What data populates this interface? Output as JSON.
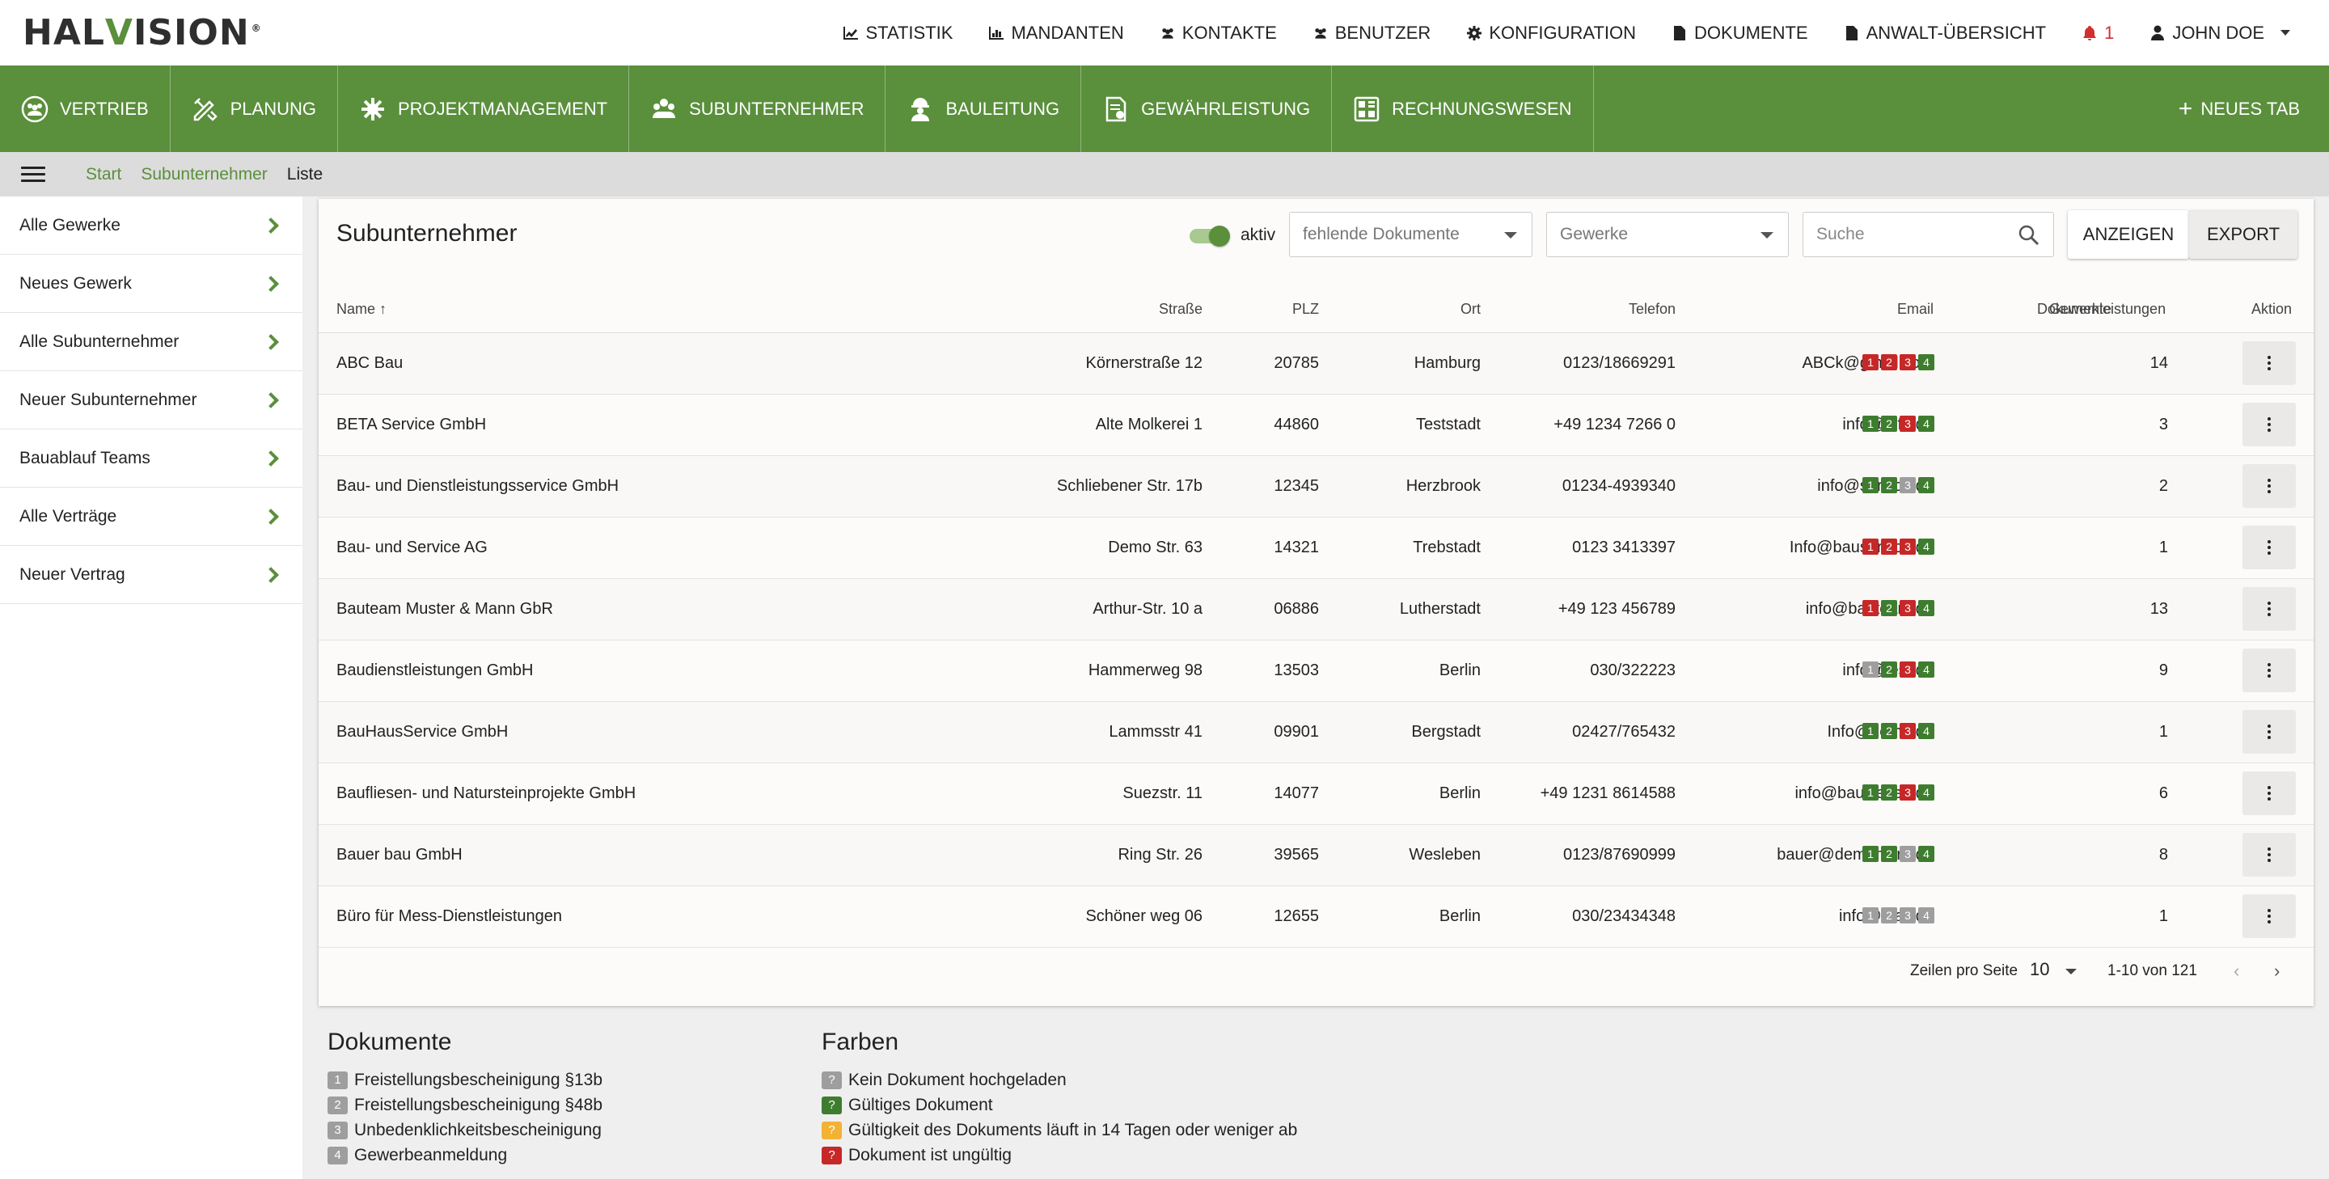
{
  "brand": {
    "logo_left": "HAL",
    "logo_v": "V",
    "logo_right": "ISION",
    "reg": "®"
  },
  "topnav": [
    {
      "label": "STATISTIK",
      "icon": "chart-line-icon"
    },
    {
      "label": "MANDANTEN",
      "icon": "bar-chart-icon"
    },
    {
      "label": "KONTAKTE",
      "icon": "users-icon"
    },
    {
      "label": "BENUTZER",
      "icon": "users-icon"
    },
    {
      "label": "KONFIGURATION",
      "icon": "gear-icon"
    },
    {
      "label": "DOKUMENTE",
      "icon": "file-icon"
    },
    {
      "label": "ANWALT-ÜBERSICHT",
      "icon": "file-icon"
    }
  ],
  "notifications": {
    "count": "1",
    "color": "#d32f2f"
  },
  "user": {
    "name": "JOHN DOE"
  },
  "mainnav": [
    {
      "label": "VERTRIEB",
      "icon": "sales-icon"
    },
    {
      "label": "PLANUNG",
      "icon": "planning-icon"
    },
    {
      "label": "PROJEKTMANAGEMENT",
      "icon": "project-icon"
    },
    {
      "label": "SUBUNTERNEHMER",
      "icon": "subcontractor-icon"
    },
    {
      "label": "BAULEITUNG",
      "icon": "worker-icon"
    },
    {
      "label": "GEWÄHRLEISTUNG",
      "icon": "warranty-icon"
    },
    {
      "label": "RECHNUNGSWESEN",
      "icon": "accounting-icon"
    }
  ],
  "newtab": "NEUES TAB",
  "breadcrumb": {
    "start": "Start",
    "section": "Subunternehmer",
    "current": "Liste"
  },
  "sidebar": [
    "Alle Gewerke",
    "Neues Gewerk",
    "Alle Subunternehmer",
    "Neuer Subunternehmer",
    "Bauablauf Teams",
    "Alle Verträge",
    "Neuer Vertrag"
  ],
  "card": {
    "title": "Subunternehmer",
    "toggle_label": "aktiv",
    "filter_docs": "fehlende Dokumente",
    "filter_trades": "Gewerke",
    "search_placeholder": "Suche",
    "btn_show": "ANZEIGEN",
    "btn_export": "EXPORT"
  },
  "columns": {
    "name": "Name",
    "street": "Straße",
    "plz": "PLZ",
    "city": "Ort",
    "phone": "Telefon",
    "email": "Email",
    "docs": "Dokumente",
    "warranty": "Gewerkleistungen",
    "action": "Aktion"
  },
  "rows": [
    {
      "name": "ABC Bau",
      "street": "Körnerstraße 12",
      "plz": "20785",
      "city": "Hamburg",
      "phone": "0123/18669291",
      "email": "ABCk@gmail.com",
      "docs": [
        "r",
        "r",
        "r",
        "g"
      ],
      "count": "14"
    },
    {
      "name": "BETA Service GmbH",
      "street": "Alte Molkerei 1",
      "plz": "44860",
      "city": "Teststadt",
      "phone": "+49 1234 7266 0",
      "email": "info@info.de",
      "docs": [
        "g",
        "g",
        "r",
        "g"
      ],
      "count": "3"
    },
    {
      "name": "Bau- und Dienstleistungsservice GmbH",
      "street": "Schliebener Str. 17b",
      "plz": "12345",
      "city": "Herzbrook",
      "phone": "01234-4939340",
      "email": "info@service.de",
      "docs": [
        "g",
        "g",
        "x",
        "g"
      ],
      "count": "2"
    },
    {
      "name": "Bau- und Service AG",
      "street": "Demo Str. 63",
      "plz": "14321",
      "city": "Trebstadt",
      "phone": "0123 3413397",
      "email": "Info@bauservice.de",
      "docs": [
        "r",
        "r",
        "r",
        "g"
      ],
      "count": "1"
    },
    {
      "name": "Bauteam Muster & Mann GbR",
      "street": "Arthur-Str. 10 a",
      "plz": "06886",
      "city": "Lutherstadt",
      "phone": "+49 123 456789",
      "email": "info@bauteam.de",
      "docs": [
        "r",
        "g",
        "r",
        "g"
      ],
      "count": "13"
    },
    {
      "name": "Baudienstleistungen GmbH",
      "street": "Hammerweg 98",
      "plz": "13503",
      "city": "Berlin",
      "phone": "030/322223",
      "email": "info@test.de",
      "docs": [
        "x",
        "g",
        "r",
        "g"
      ],
      "count": "9"
    },
    {
      "name": "BauHausService GmbH",
      "street": "Lammsstr 41",
      "plz": "09901",
      "city": "Bergstadt",
      "phone": "02427/765432",
      "email": "Info@demo.de",
      "docs": [
        "g",
        "g",
        "r",
        "g"
      ],
      "count": "1"
    },
    {
      "name": "Baufliesen- und Natursteinprojekte GmbH",
      "street": "Suezstr. 11",
      "plz": "14077",
      "city": "Berlin",
      "phone": "+49 1231 8614588",
      "email": "info@baufliesen.de",
      "docs": [
        "g",
        "g",
        "r",
        "g"
      ],
      "count": "6"
    },
    {
      "name": "Bauer bau GmbH",
      "street": "Ring Str. 26",
      "plz": "39565",
      "city": "Wesleben",
      "phone": "0123/87690999",
      "email": "bauer@demonstra.de",
      "docs": [
        "g",
        "g",
        "x",
        "g"
      ],
      "count": "8"
    },
    {
      "name": "Büro für Mess-Dienstleistungen",
      "street": "Schöner weg 06",
      "plz": "12655",
      "city": "Berlin",
      "phone": "030/23434348",
      "email": "info@mail.de",
      "docs": [
        "x",
        "x",
        "x",
        "x"
      ],
      "count": "1"
    }
  ],
  "pager": {
    "label": "Zeilen pro Seite",
    "per_page": "10",
    "range": "1-10 von 121",
    "prev": "‹",
    "next": "›"
  },
  "legend_docs": {
    "title": "Dokumente",
    "items": [
      {
        "num": "1",
        "text": "Freistellungsbescheinigung §13b"
      },
      {
        "num": "2",
        "text": "Freistellungsbescheinigung §48b"
      },
      {
        "num": "3",
        "text": "Unbedenklichkeitsbescheinigung"
      },
      {
        "num": "4",
        "text": "Gewerbeanmeldung"
      }
    ]
  },
  "legend_colors": {
    "title": "Farben",
    "items": [
      {
        "mark": "?",
        "color": "x",
        "text": "Kein Dokument hochgeladen"
      },
      {
        "mark": "?",
        "color": "g",
        "text": "Gültiges Dokument"
      },
      {
        "mark": "?",
        "color": "y",
        "text": "Gültigkeit des Dokuments läuft in 14 Tagen oder weniger ab"
      },
      {
        "mark": "?",
        "color": "r",
        "text": "Dokument ist ungültig"
      }
    ]
  },
  "colors": {
    "brand_green": "#5a8f3c",
    "valid": "#3e7d2f",
    "invalid": "#c62828",
    "missing": "#9e9e9e",
    "expiring": "#f2b233"
  }
}
